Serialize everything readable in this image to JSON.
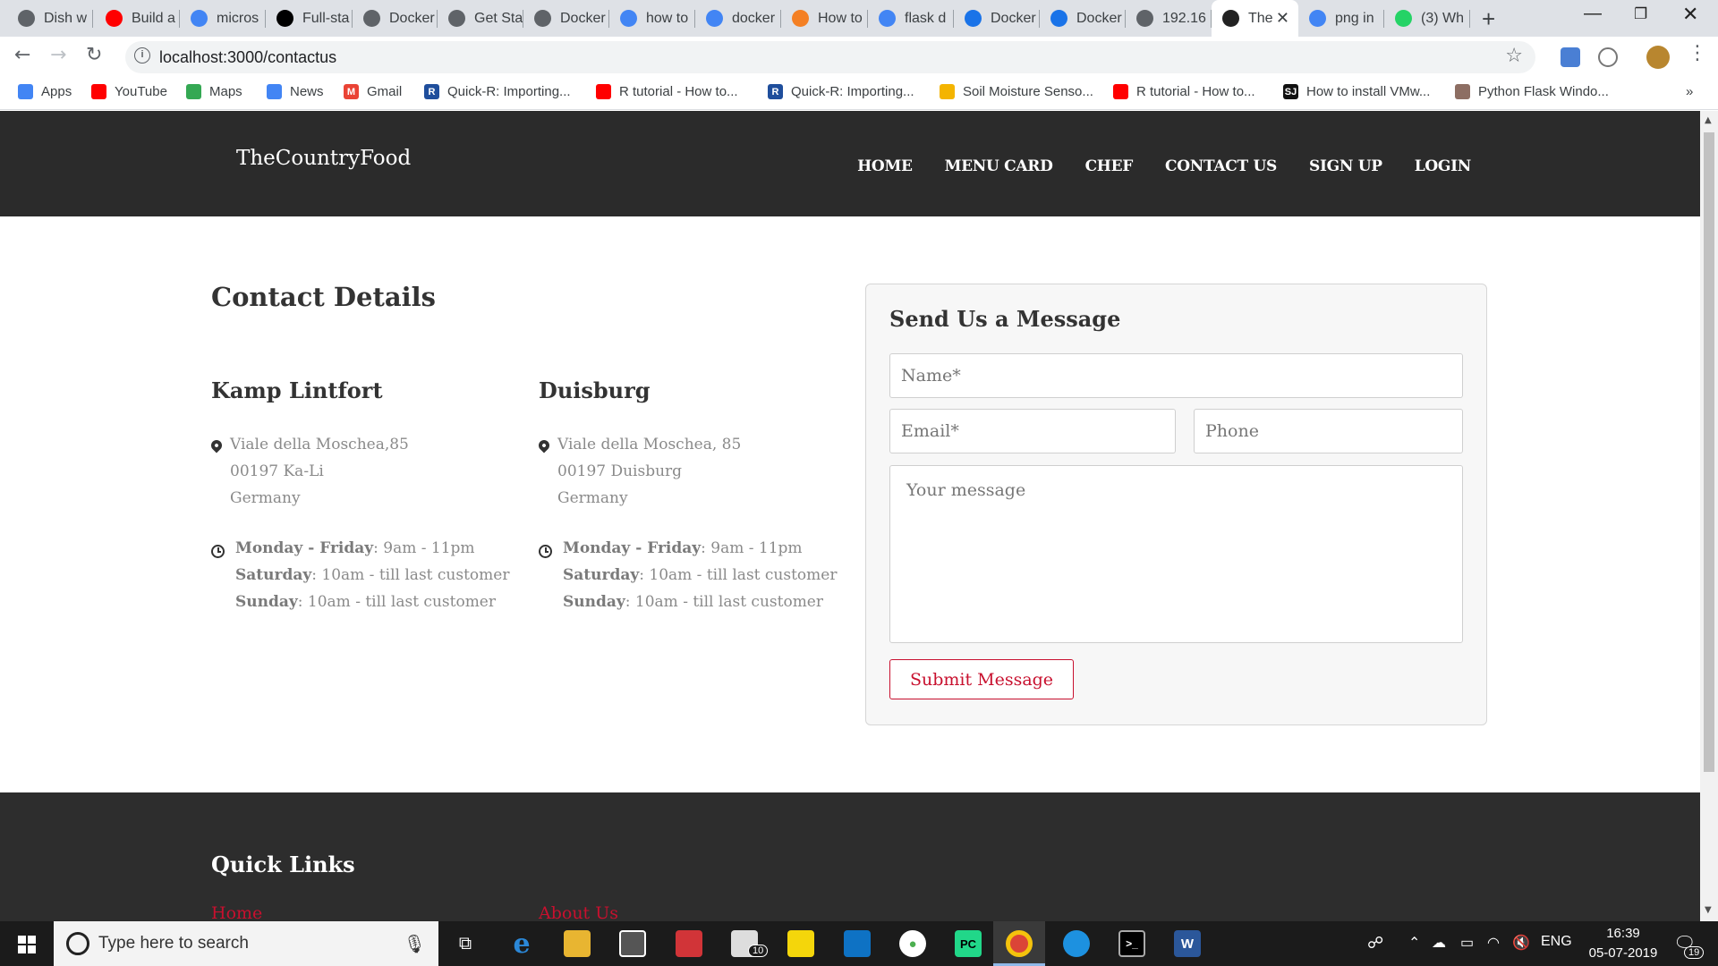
{
  "browser": {
    "tabs": [
      {
        "label": "Dish w",
        "icon": "globe-icon"
      },
      {
        "label": "Build a",
        "icon": "youtube-icon"
      },
      {
        "label": "micros",
        "icon": "google-icon"
      },
      {
        "label": "Full-sta",
        "icon": "medium-icon"
      },
      {
        "label": "Docker",
        "icon": "docker-icon"
      },
      {
        "label": "Get Sta",
        "icon": "docker-icon"
      },
      {
        "label": "Docker",
        "icon": "docker-icon"
      },
      {
        "label": "how to",
        "icon": "google-icon"
      },
      {
        "label": "docker",
        "icon": "google-icon"
      },
      {
        "label": "How to",
        "icon": "stackoverflow-icon"
      },
      {
        "label": "flask d",
        "icon": "google-icon"
      },
      {
        "label": "Docker",
        "icon": "slash-icon"
      },
      {
        "label": "Docker",
        "icon": "slash-icon"
      },
      {
        "label": "192.16",
        "icon": "globe-icon"
      },
      {
        "label": "The",
        "icon": "react-icon",
        "active": true
      },
      {
        "label": "png in",
        "icon": "google-icon"
      },
      {
        "label": "(3) Wh",
        "icon": "whatsapp-icon"
      }
    ],
    "url": "localhost:3000/contactus",
    "bookmarks": [
      {
        "label": "Apps",
        "icon": "apps-grid-icon"
      },
      {
        "label": "YouTube",
        "icon": "youtube-icon"
      },
      {
        "label": "Maps",
        "icon": "maps-icon"
      },
      {
        "label": "News",
        "icon": "news-icon"
      },
      {
        "label": "Gmail",
        "icon": "gmail-icon"
      },
      {
        "label": "Quick-R: Importing...",
        "icon": "r-icon"
      },
      {
        "label": "R tutorial - How to...",
        "icon": "youtube-icon"
      },
      {
        "label": "Quick-R: Importing...",
        "icon": "r-icon"
      },
      {
        "label": "Soil Moisture Senso...",
        "icon": "person-icon"
      },
      {
        "label": "R tutorial - How to...",
        "icon": "youtube-icon"
      },
      {
        "label": "How to install VMw...",
        "icon": "sj-icon"
      },
      {
        "label": "Python Flask Windo...",
        "icon": "avatar-icon"
      }
    ],
    "bookmarks_overflow": "»"
  },
  "site": {
    "brand": "TheCountryFood",
    "nav": [
      "HOME",
      "MENU CARD",
      "CHEF",
      "CONTACT US",
      "SIGN UP",
      "LOGIN"
    ],
    "contact_title": "Contact Details",
    "locations": [
      {
        "name": "Kamp Lintfort",
        "address": [
          "Viale della Moschea,85",
          "00197 Ka-Li",
          "Germany"
        ],
        "hours": [
          {
            "days": "Monday - Friday",
            "time": ": 9am - 11pm"
          },
          {
            "days": "Saturday",
            "time": ": 10am - till last customer"
          },
          {
            "days": "Sunday",
            "time": ": 10am - till last customer"
          }
        ]
      },
      {
        "name": "Duisburg",
        "address": [
          "Viale della Moschea, 85",
          "00197 Duisburg",
          "Germany"
        ],
        "hours": [
          {
            "days": "Monday - Friday",
            "time": ": 9am - 11pm"
          },
          {
            "days": "Saturday",
            "time": ": 10am - till last customer"
          },
          {
            "days": "Sunday",
            "time": ": 10am - till last customer"
          }
        ]
      }
    ],
    "form": {
      "title": "Send Us a Message",
      "name_placeholder": "Name*",
      "email_placeholder": "Email*",
      "phone_placeholder": "Phone",
      "message_placeholder": "Your message",
      "submit_label": "Submit Message"
    },
    "footer": {
      "title": "Quick Links",
      "links": [
        "Home",
        "About Us"
      ]
    }
  },
  "taskbar": {
    "search_placeholder": "Type here to search",
    "mail_badge": "10",
    "notif_badge": "19",
    "language": "ENG",
    "time": "16:39",
    "date": "05-07-2019"
  },
  "colors": {
    "header_bg": "#2b2b2b",
    "accent_red": "#c8102e",
    "footer_bg": "#2d2d2d"
  }
}
